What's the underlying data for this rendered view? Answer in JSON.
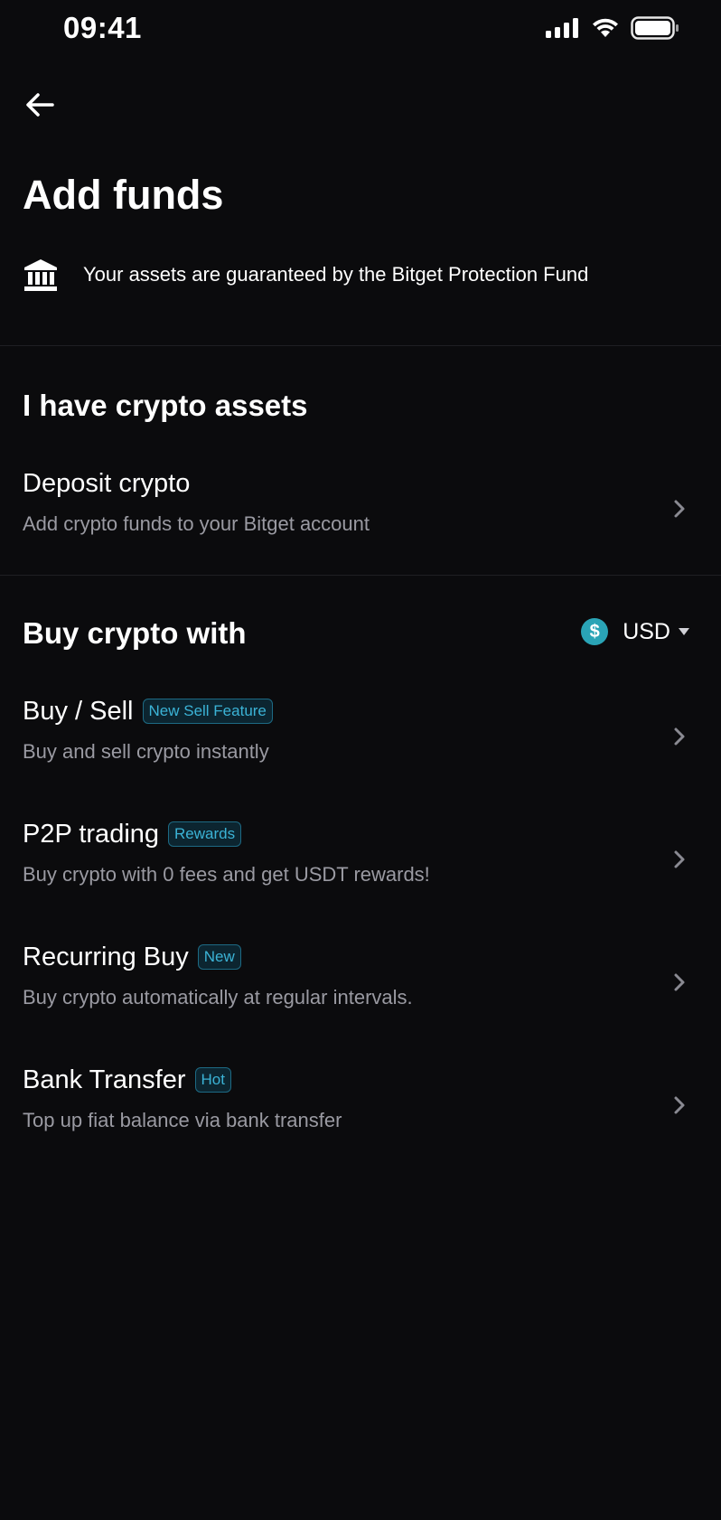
{
  "status_bar": {
    "time": "09:41"
  },
  "header": {
    "back_icon": "arrow-left-icon",
    "title": "Add funds"
  },
  "protection": {
    "icon": "bank-icon",
    "text": "Your assets are guaranteed by the Bitget Protection Fund"
  },
  "crypto_section": {
    "title": "I have crypto assets",
    "items": [
      {
        "title": "Deposit crypto",
        "subtitle": "Add crypto funds to your Bitget account"
      }
    ]
  },
  "buy_section": {
    "title": "Buy crypto with",
    "currency": {
      "icon": "dollar-coin-icon",
      "symbol": "$",
      "label": "USD"
    },
    "items": [
      {
        "title": "Buy / Sell",
        "badge": "New Sell Feature",
        "subtitle": "Buy and sell crypto instantly"
      },
      {
        "title": "P2P trading",
        "badge": "Rewards",
        "subtitle": "Buy crypto with 0 fees and get USDT rewards!"
      },
      {
        "title": "Recurring Buy",
        "badge": "New",
        "subtitle": "Buy crypto automatically at regular intervals."
      },
      {
        "title": "Bank Transfer",
        "badge": "Hot",
        "subtitle": "Top up fiat balance via bank transfer"
      }
    ]
  },
  "colors": {
    "background": "#0b0b0d",
    "accent": "#3bb3d6",
    "subtitle": "#9a9aa2",
    "coin": "#2aa4b6"
  }
}
